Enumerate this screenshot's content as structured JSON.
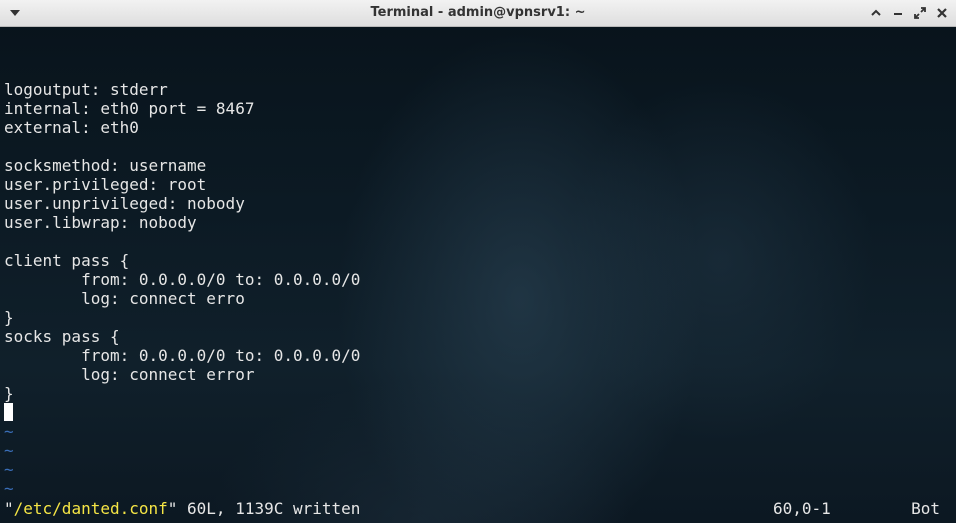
{
  "window": {
    "title": "Terminal - admin@vpnsrv1: ~",
    "controls": {
      "menu": "chevron-down-icon",
      "shade": "chevron-up-icon",
      "minimize": "minimize-icon",
      "maximize": "maximize-icon",
      "close": "close-icon"
    }
  },
  "editor": {
    "lines": [
      "logoutput: stderr",
      "internal: eth0 port = 8467",
      "external: eth0",
      "",
      "socksmethod: username",
      "user.privileged: root",
      "user.unprivileged: nobody",
      "user.libwrap: nobody",
      "",
      "client pass {",
      "        from: 0.0.0.0/0 to: 0.0.0.0/0",
      "        log: connect erro",
      "}",
      "socks pass {",
      "        from: 0.0.0.0/0 to: 0.0.0.0/0",
      "        log: connect error",
      "}",
      ""
    ],
    "tilde_lines": [
      "~",
      "~",
      "~",
      "~"
    ],
    "status": {
      "quote_open": "\"",
      "file": "/etc/danted.conf",
      "rest": "\" 60L, 1139C written",
      "position": "60,0-1",
      "scroll": "Bot"
    }
  },
  "colors": {
    "text": "#e6e6e6",
    "tilde": "#3a6eb8",
    "filename": "#f5e545",
    "cursor": "#ffffff",
    "titlebar": "#e6e6e6"
  }
}
